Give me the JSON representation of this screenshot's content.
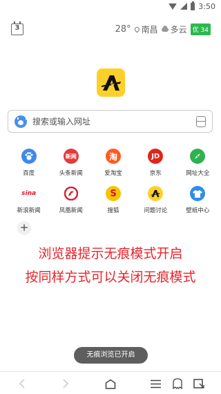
{
  "status": {
    "time": "3:50"
  },
  "header": {
    "calendar_day": "3",
    "temperature": "28°",
    "city": "南昌",
    "weather": "多云",
    "aqi": "优 34",
    "aqi_color": "#2db84d"
  },
  "search": {
    "placeholder": "搜索或输入网址"
  },
  "shortcuts": [
    {
      "label": "百度",
      "icon": "baidu-icon",
      "color": "#3f89ec"
    },
    {
      "label": "头条新闻",
      "icon": "toutiao-news-icon",
      "color": "#e23c3c"
    },
    {
      "label": "爱淘宝",
      "icon": "taobao-icon",
      "color": "#ff5a1f"
    },
    {
      "label": "京东",
      "icon": "jd-icon",
      "color": "#e1251b"
    },
    {
      "label": "网址大全",
      "icon": "compass-icon",
      "color": "#2eb24f"
    },
    {
      "label": "新浪新闻",
      "icon": "sina-icon",
      "color": "#e6162d"
    },
    {
      "label": "凤凰新闻",
      "icon": "ifeng-icon",
      "color": "#d9212c"
    },
    {
      "label": "搜狐",
      "icon": "sohu-icon",
      "color": "#f6c400"
    },
    {
      "label": "问题讨论",
      "icon": "discussion-icon",
      "color": "#fcd02a"
    },
    {
      "label": "壁纸中心",
      "icon": "tshirt-icon",
      "color": "#2f8ee8"
    }
  ],
  "add_label": "+",
  "caption": {
    "line1": "浏览器提示无痕模式开启",
    "line2": "按同样方式可以关闭无痕模式",
    "color": "#e8242a"
  },
  "toast": {
    "text": "无痕浏览已开启"
  },
  "icon_texts": {
    "jd": "JD",
    "tao": "淘",
    "sina": "sina",
    "news": "新闻"
  }
}
